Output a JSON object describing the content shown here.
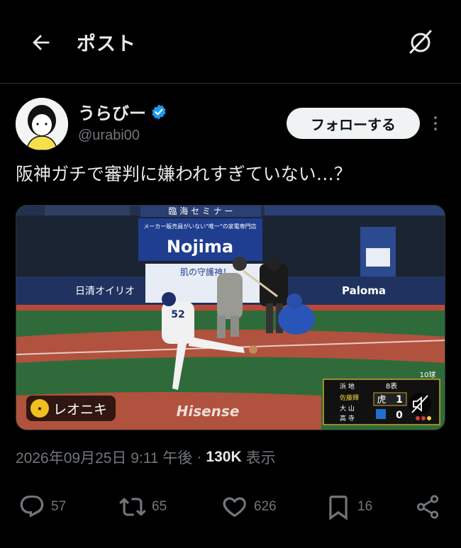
{
  "header": {
    "title": "ポスト",
    "back_icon": "arrow-left-icon",
    "grok_icon": "grok-icon"
  },
  "author": {
    "name": "うらびー",
    "handle": "@urabi00",
    "verified": true,
    "follow_label": "フォローする"
  },
  "tweet": {
    "text": "阪神ガチで審判に嫌われすぎていない…？"
  },
  "media": {
    "source_label": "レオニキ",
    "scoreboard": {
      "inning": "8表",
      "count_label": "10球",
      "team_top": "虎",
      "score_top": "1",
      "score_bottom": "0",
      "batters": [
        "浜 地",
        "佐藤輝",
        "大 山",
        "高 寺"
      ]
    },
    "ads": {
      "nojima": "Nojima",
      "nissin": "日清オイリオ",
      "paloma": "Paloma",
      "hisense": "Hisense",
      "banner_top": "臨 海 セ ミ ナ ー",
      "banner_sub": "メーカー販売員がいない\"唯一\"の家電専門店",
      "banner_mid": "肌の守護神！"
    }
  },
  "meta": {
    "timestamp": "2026年09月25日 9:11 午後",
    "separator": "·",
    "views": "130K",
    "views_label": "表示"
  },
  "actions": {
    "replies": "57",
    "reposts": "65",
    "likes": "626",
    "bookmarks": "16"
  }
}
